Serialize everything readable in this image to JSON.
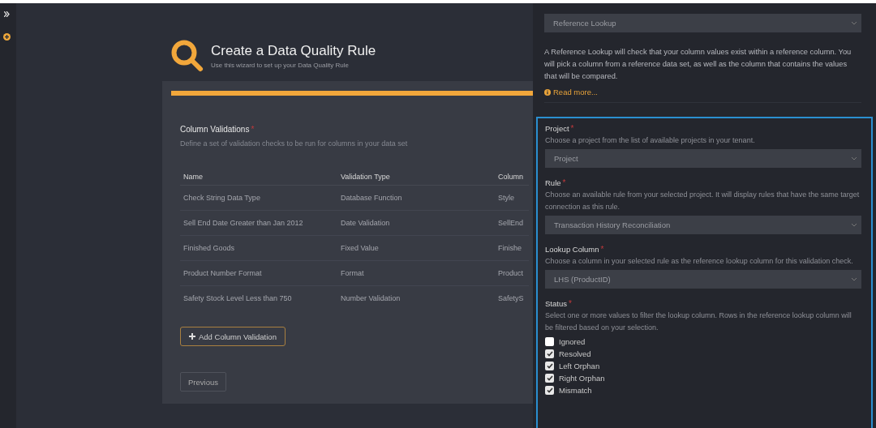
{
  "header": {
    "title": "Create a Data Quality Rule",
    "subtitle": "Use this wizard to set up your Data Quality Rule"
  },
  "wizard": {
    "progress": {
      "level": 1
    },
    "section": {
      "title": "Column Validations",
      "required_mark": "*",
      "description": "Define a set of validation checks to be run for columns in your data set"
    },
    "table": {
      "columns": [
        "Name",
        "Validation Type",
        "Column"
      ],
      "rows": [
        [
          "Check String Data Type",
          "Database Function",
          "Style"
        ],
        [
          "Sell End Date Greater than Jan 2012",
          "Date Validation",
          "SellEnd"
        ],
        [
          "Finished Goods",
          "Fixed Value",
          "Finishe"
        ],
        [
          "Product Number Format",
          "Format",
          "Product"
        ],
        [
          "Safety Stock Level Less than 750",
          "Number Validation",
          "SafetyS"
        ]
      ]
    },
    "add_button": "Add Column Validation",
    "previous_button": "Previous"
  },
  "panel": {
    "validation_type": {
      "value": "Reference Lookup"
    },
    "description": "A Reference Lookup will check that your column values exist within a reference column. You will pick a column from a reference data set, as well as the column that contains the values that will be compared.",
    "read_more": "Read more...",
    "fields": [
      {
        "kind": "select",
        "label": "Project",
        "required_mark": "*",
        "description": "Choose a project from the list of available projects in your tenant.",
        "placeholder": "Project"
      },
      {
        "kind": "select",
        "label": "Rule",
        "required_mark": "*",
        "description": "Choose an available rule from your selected project. It will display rules that have the same target connection as this rule.",
        "value": "Transaction History Reconciliation"
      },
      {
        "kind": "select",
        "label": "Lookup Column",
        "required_mark": "*",
        "description": "Choose a column in your selected rule as the reference lookup column for this validation check.",
        "value": "LHS (ProductID)"
      },
      {
        "kind": "checkboxes",
        "label": "Status",
        "required_mark": "*",
        "description": "Select one or more values to filter the lookup column. Rows in the reference lookup column will be filtered based on your selection.",
        "options": [
          {
            "label": "Ignored",
            "checked": false
          },
          {
            "label": "Resolved",
            "checked": true
          },
          {
            "label": "Left Orphan",
            "checked": true
          },
          {
            "label": "Right Orphan",
            "checked": true
          },
          {
            "label": "Mismatch",
            "checked": true
          }
        ]
      }
    ]
  }
}
